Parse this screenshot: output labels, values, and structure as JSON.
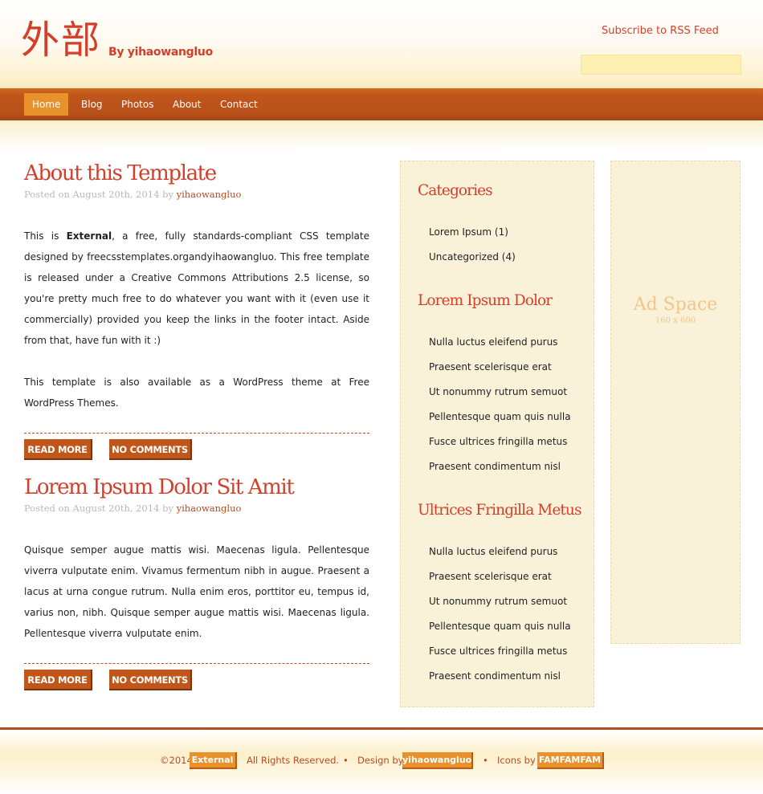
{
  "header": {
    "logo": "外部",
    "byline": "By yihaowangluo",
    "rss": "Subscribe to RSS Feed",
    "search_value": ""
  },
  "nav": {
    "items": [
      {
        "label": "Home",
        "active": true
      },
      {
        "label": "Blog",
        "active": false
      },
      {
        "label": "Photos",
        "active": false
      },
      {
        "label": "About",
        "active": false
      },
      {
        "label": "Contact",
        "active": false
      }
    ]
  },
  "posts": [
    {
      "title": "About this Template",
      "meta_prefix": "Posted on August 20th, 2014 by ",
      "author": "yihaowangluo",
      "para1_a": "This is ",
      "para1_b": "External",
      "para1_c": ", a free, fully standards-compliant CSS template designed by freecsstemplates.organdyihaowangluo. This free template is released under a Creative Commons Attributions 2.5 license, so you're pretty much free to do whatever you want with it (even use it commercially) provided you keep the links in the footer intact. Aside from that, have fun with it :)",
      "para2": "This template is also available as a WordPress theme at Free WordPress Themes.",
      "read_more": "READ MORE",
      "comments": "NO COMMENTS"
    },
    {
      "title": "Lorem Ipsum Dolor Sit Amit",
      "meta_prefix": "Posted on August 20th, 2014 by ",
      "author": "yihaowangluo",
      "para1": "Quisque semper augue mattis wisi. Maecenas ligula. Pellentesque viverra vulputate enim. Vivamus fermentum nibh in augue. Praesent a lacus at urna congue rutrum. Nulla enim eros, porttitor eu, tempus id, varius non, nibh. Quisque semper augue mattis wisi. Maecenas ligula. Pellentesque viverra vulputate enim.",
      "read_more": "READ MORE",
      "comments": "NO COMMENTS"
    }
  ],
  "sidebar": {
    "categories_title": "Categories",
    "categories": [
      "Lorem Ipsum (1)",
      "Uncategorized (4)"
    ],
    "section2_title": "Lorem Ipsum Dolor",
    "section2_items": [
      "Nulla luctus eleifend purus",
      "Praesent scelerisque erat",
      "Ut nonummy rutrum semuot",
      "Pellentesque quam quis nulla",
      "Fusce ultrices fringilla metus",
      "Praesent condimentum nisl"
    ],
    "section3_title": "Ultrices Fringilla Metus",
    "section3_items": [
      "Nulla luctus eleifend purus",
      "Praesent scelerisque erat",
      "Ut nonummy rutrum semuot",
      "Pellentesque quam quis nulla",
      "Fusce ultrices fringilla metus",
      "Praesent condimentum nisl"
    ]
  },
  "ad": {
    "title": "Ad Space",
    "size": "160 x 600"
  },
  "footer": {
    "copyright": "©2014",
    "site_badge": "External",
    "rights": "All Rights Reserved.",
    "bullet": "•",
    "design_by": "Design by",
    "designer_badge": "yihaowangluo",
    "icons_by": "Icons by",
    "icons_badge": "FAMFAMFAM"
  },
  "colors": {
    "accent": "#d2402b",
    "nav": "#b8501a",
    "highlight": "#e8922d",
    "sidebar_bg": "#f9f2d9"
  }
}
